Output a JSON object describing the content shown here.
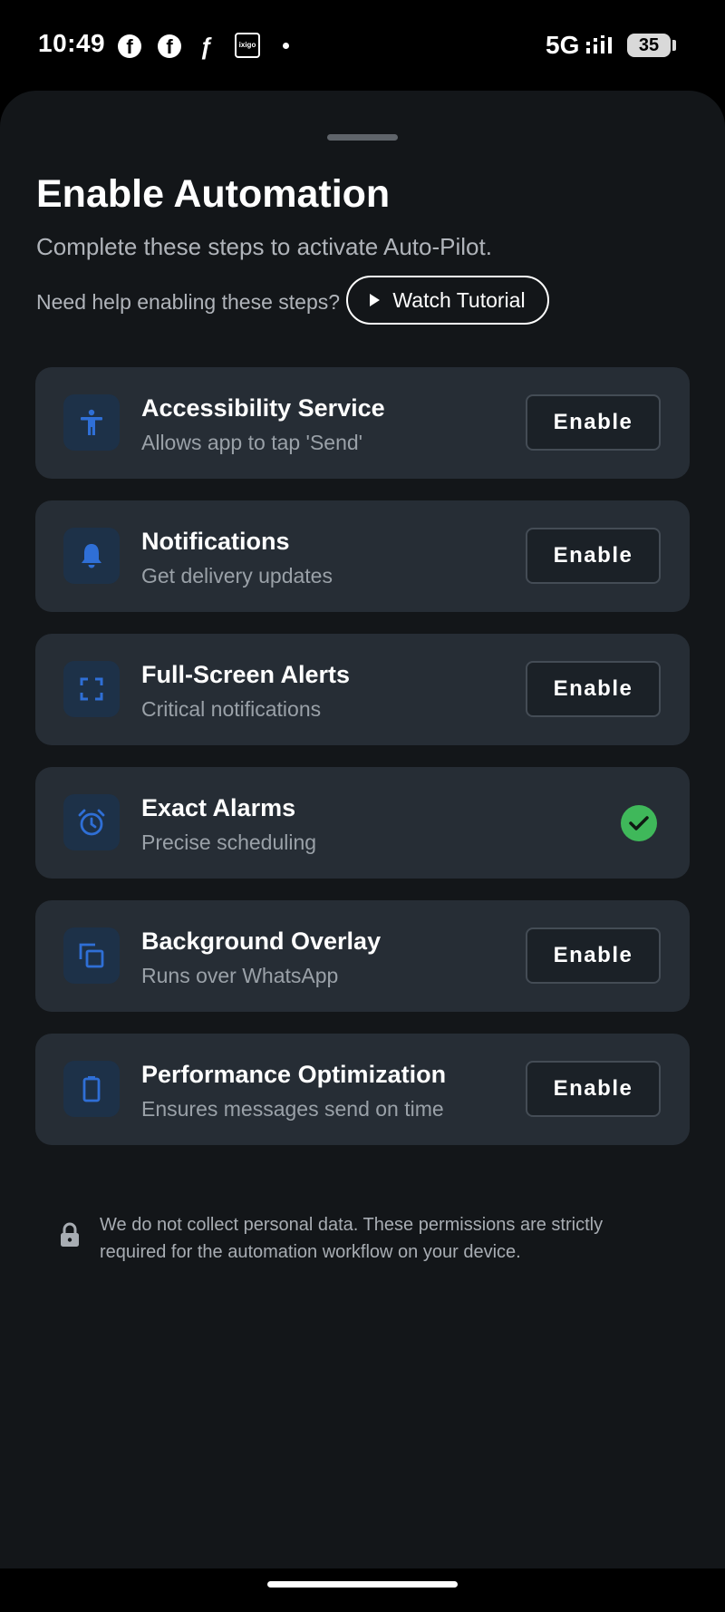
{
  "status_bar": {
    "time": "10:49",
    "network": "5G",
    "battery": "35",
    "app_icons": [
      "facebook-icon",
      "facebook-icon",
      "flipkart-icon",
      "ixigo-icon"
    ],
    "ixigo_label": "ixigo"
  },
  "sheet": {
    "title": "Enable Automation",
    "subtitle": "Complete these steps to activate Auto-Pilot.",
    "help_text": "Need help enabling these steps?",
    "tutorial_label": "Watch Tutorial"
  },
  "steps": [
    {
      "title": "Accessibility Service",
      "desc": "Allows app to tap 'Send'",
      "icon": "accessibility-icon",
      "action": "Enable",
      "done": false
    },
    {
      "title": "Notifications",
      "desc": "Get delivery updates",
      "icon": "bell-icon",
      "action": "Enable",
      "done": false
    },
    {
      "title": "Full-Screen Alerts",
      "desc": "Critical notifications",
      "icon": "fullscreen-icon",
      "action": "Enable",
      "done": false
    },
    {
      "title": "Exact Alarms",
      "desc": "Precise scheduling",
      "icon": "alarm-icon",
      "action": "",
      "done": true
    },
    {
      "title": "Background Overlay",
      "desc": "Runs over WhatsApp",
      "icon": "overlay-icon",
      "action": "Enable",
      "done": false
    },
    {
      "title": "Performance Optimization",
      "desc": "Ensures messages send on time",
      "icon": "battery-icon",
      "action": "Enable",
      "done": false
    }
  ],
  "privacy": {
    "text": "We do not collect personal data. These permissions are strictly required for the automation workflow on your device."
  },
  "colors": {
    "accent": "#2f6fd6",
    "success": "#3fb85a",
    "card": "#262d35",
    "sheet": "#131619"
  }
}
